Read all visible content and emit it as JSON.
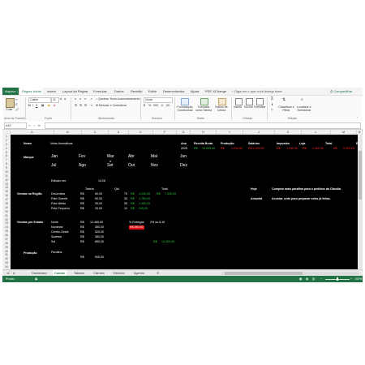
{
  "ribbon_tabs": [
    "Arquivo",
    "Página Inicial",
    "Inserir",
    "Layout da Página",
    "Fórmulas",
    "Dados",
    "Revisão",
    "Exibir",
    "Desenvolvedor",
    "Ajuda",
    "PDF-XChange"
  ],
  "tell_me": "Diga-me o que você deseja fazer",
  "share": "Compartilhar",
  "ribbon": {
    "paste": "Colar",
    "font_name": "Calibri",
    "font_size": "11",
    "wrap_text": "Quebrar Texto Automaticamente",
    "merge_center": "Mesclar e Centralizar",
    "number_format": "Geral",
    "conditional_format": "Formatação Condicional",
    "format_table": "Formatar como Tabela",
    "cell_styles": "Estilos de Célula",
    "insert": "Inserir",
    "delete": "Excluir",
    "format": "Formatar",
    "sort_filter": "Classificar e Filtrar",
    "find_select": "Localizar e Selecionar",
    "groups": [
      "Área de Transfe...",
      "Fonte",
      "Alinhamento",
      "Número",
      "Estilo",
      "Células",
      "Edição"
    ]
  },
  "formula_bar": {
    "name_box": "A43",
    "fx": "fx",
    "value": ""
  },
  "columns": [
    "A",
    "B",
    "C",
    "D",
    "E",
    "F",
    "G",
    "H",
    "I",
    "J",
    "K",
    "L",
    "M",
    "N"
  ],
  "rows": [
    "1",
    "2",
    "3",
    "4",
    "5",
    "6",
    "7",
    "8",
    "9",
    "10",
    "11",
    "12",
    "13",
    "14",
    "15",
    "16",
    "17",
    "18",
    "19",
    "20",
    "21",
    "22",
    "23",
    "24",
    "25",
    "26",
    "27",
    "28",
    "29",
    "30",
    "31",
    "32",
    "33",
    "34"
  ],
  "sheet": {
    "nome_label": "Nome",
    "nome_value": "Velas Aromáticas",
    "marque_label": "Marque",
    "months_row1": [
      "Jan",
      "Fev",
      "Mar",
      "Abr",
      "Mai",
      "Jun"
    ],
    "months_row2": [
      "Jul",
      "Ago",
      "Set",
      "Out",
      "Nov",
      "Dez"
    ],
    "editado_label": "Editado em:",
    "editado_value": "14:28",
    "summary_headers": [
      "Ano",
      "Receita Bruta",
      "Produção",
      "Salários",
      "Impostos",
      "Loja",
      "Total",
      "Re"
    ],
    "summary_values": [
      "2025",
      "R$",
      "19.395,00",
      "R$",
      "1.040,00",
      "R$ 2.000,00",
      "R$",
      "1.040,00",
      "R$",
      "1.000,00",
      "R$",
      "9.300,00"
    ],
    "region_label": "Vendas na Região",
    "tabela_header": "Tabela",
    "qtd_header": "Qtd",
    "total_header": "Total",
    "region_rows": [
      {
        "item": "Decorativa",
        "cur": "R$",
        "price": "60,00",
        "qtd": "70",
        "tcur": "R$",
        "total": "4.200,00"
      },
      {
        "item": "Pote Grande",
        "cur": "R$",
        "price": "50,00",
        "qtd": "35",
        "tcur": "R$",
        "total": "1.750,00"
      },
      {
        "item": "Pote Médio",
        "cur": "R$",
        "price": "35,00",
        "qtd": "35",
        "tcur": "R$",
        "total": "1.400,00"
      },
      {
        "item": "Pote Pequeno",
        "cur": "R$",
        "price": "20,00",
        "qtd": "12",
        "tcur": "R$",
        "total": "240,00"
      }
    ],
    "region_sum": {
      "cur": "R$",
      "value": "7.315,00"
    },
    "hoje_label": "Hoje",
    "hoje_text": "Comprar mais parafina para o pedidos da Cláudia.",
    "amanha_label": "Amanhã",
    "amanha_text": "Acordar cedo para preparar velas já feitas.",
    "estado_label": "Vendas por Estado",
    "estado_rows": [
      {
        "region": "Norte",
        "cur": "R$",
        "value": "12.465,00"
      },
      {
        "region": "Nordeste",
        "cur": "R$",
        "value": "350,00"
      },
      {
        "region": "Centro-Oeste",
        "cur": "R$",
        "value": "525,00"
      },
      {
        "region": "Sudeste",
        "cur": "R$",
        "value": "380,00"
      },
      {
        "region": "Sul",
        "cur": "R$",
        "value": "850,00"
      }
    ],
    "entregas_label": "% Entregas",
    "entregas_value": "2% ou 6,18",
    "entregas_red": "R$ 850,00",
    "estado_total": {
      "cur": "R$",
      "value": "14.300,00"
    },
    "producao_label": "Produção",
    "producao_item": "Parafina",
    "producao_cur": "R$",
    "producao_value": "500,00"
  },
  "sheet_tabs": [
    "Dashboard",
    "Contas",
    "Tabelas",
    "Clientes",
    "Histórico",
    "Agenda"
  ],
  "active_sheet": "Contas",
  "status": {
    "left": "Pronto",
    "zoom": "100%"
  },
  "colors": {
    "excel_green": "#217346",
    "positive": "#2ecc40",
    "negative": "#ff2b2b"
  }
}
